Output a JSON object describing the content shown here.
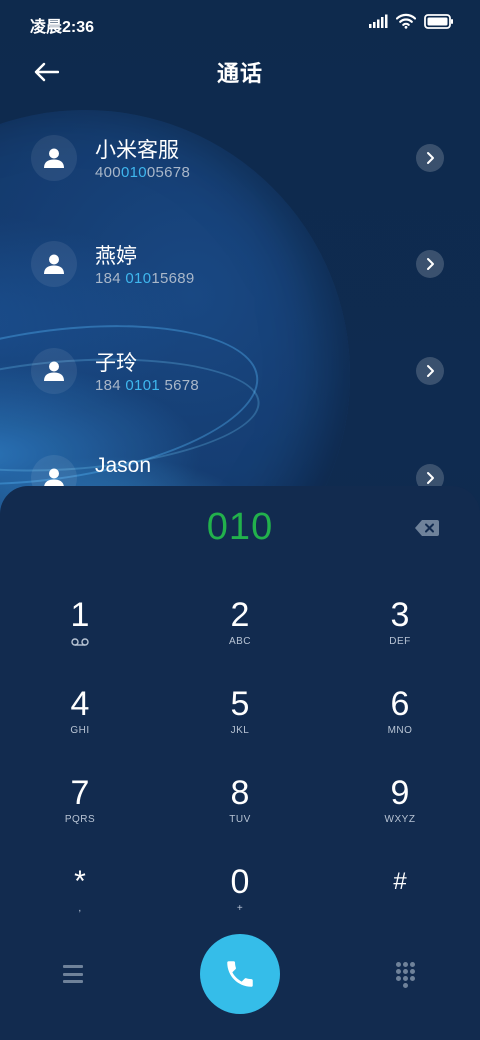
{
  "status_bar": {
    "time": "凌晨2:36",
    "icons": [
      "signal-icon",
      "wifi-icon",
      "battery-icon"
    ]
  },
  "header": {
    "title": "通话",
    "back_icon": "back-arrow-icon"
  },
  "contacts": [
    {
      "name": "小米客服",
      "number_parts": [
        "400",
        "010",
        "05678"
      ]
    },
    {
      "name": "燕婷",
      "number_parts": [
        "184 ",
        "010",
        "15689"
      ]
    },
    {
      "name": "子玲",
      "number_parts": [
        "184 ",
        "0101",
        " 5678"
      ]
    },
    {
      "name": "Jason",
      "number_parts": [
        "",
        "",
        ""
      ]
    }
  ],
  "dialer": {
    "input": "010",
    "keys": [
      {
        "digit": "1",
        "letters": "voicemail-icon"
      },
      {
        "digit": "2",
        "letters": "ABC"
      },
      {
        "digit": "3",
        "letters": "DEF"
      },
      {
        "digit": "4",
        "letters": "GHI"
      },
      {
        "digit": "5",
        "letters": "JKL"
      },
      {
        "digit": "6",
        "letters": "MNO"
      },
      {
        "digit": "7",
        "letters": "PQRS"
      },
      {
        "digit": "8",
        "letters": "TUV"
      },
      {
        "digit": "9",
        "letters": "WXYZ"
      },
      {
        "digit": "*",
        "letters": ","
      },
      {
        "digit": "0",
        "letters": "+"
      },
      {
        "digit": "#",
        "letters": ""
      }
    ]
  },
  "colors": {
    "background": "#0e2a4d",
    "dialer_panel": "#122b4f",
    "input_text": "#22b14c",
    "highlight": "#3fb7ee",
    "call_button": "#35bde9"
  }
}
